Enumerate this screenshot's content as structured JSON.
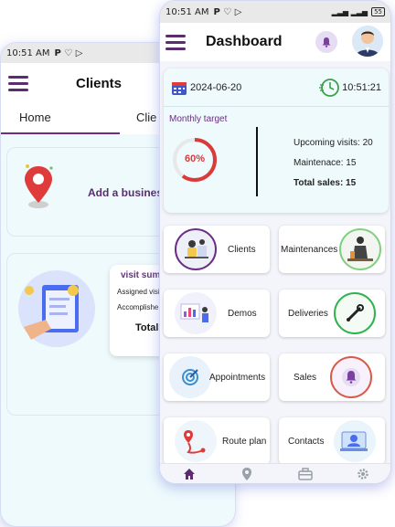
{
  "back_screen": {
    "status": {
      "time": "10:51 AM"
    },
    "title": "Clients",
    "tabs": [
      {
        "label": "Home"
      },
      {
        "label": "Clie"
      }
    ],
    "add_business_label": "Add a business",
    "visit_summary": {
      "title": "visit summ",
      "lines": [
        "Assigned visit",
        "Accomplishe"
      ],
      "total_label": "Total v"
    }
  },
  "front_screen": {
    "status": {
      "time": "10:51 AM",
      "battery": "55"
    },
    "title": "Dashboard",
    "summary": {
      "date": "2024-06-20",
      "time": "10:51:21",
      "monthly_target_label": "Monthly target",
      "target_percent_label": "60%",
      "target_fraction": 0.6,
      "upcoming_visits": "Upcoming visits: 20",
      "maintenance": "Maintenace: 15",
      "total_sales": "Total sales: 15"
    },
    "tiles": [
      {
        "label": "Clients"
      },
      {
        "label": "Maintenances"
      },
      {
        "label": "Demos"
      },
      {
        "label": "Deliveries"
      },
      {
        "label": "Appointments"
      },
      {
        "label": "Sales"
      },
      {
        "label": "Route plan"
      },
      {
        "label": "Contacts"
      }
    ],
    "nav": [
      {
        "icon": "home-icon"
      },
      {
        "icon": "location-icon"
      },
      {
        "icon": "briefcase-icon"
      },
      {
        "icon": "gear-icon"
      }
    ],
    "colors": {
      "accent": "#6b2d86",
      "ring": "#d93b3b",
      "nav_active": "#5b2c6f"
    }
  }
}
